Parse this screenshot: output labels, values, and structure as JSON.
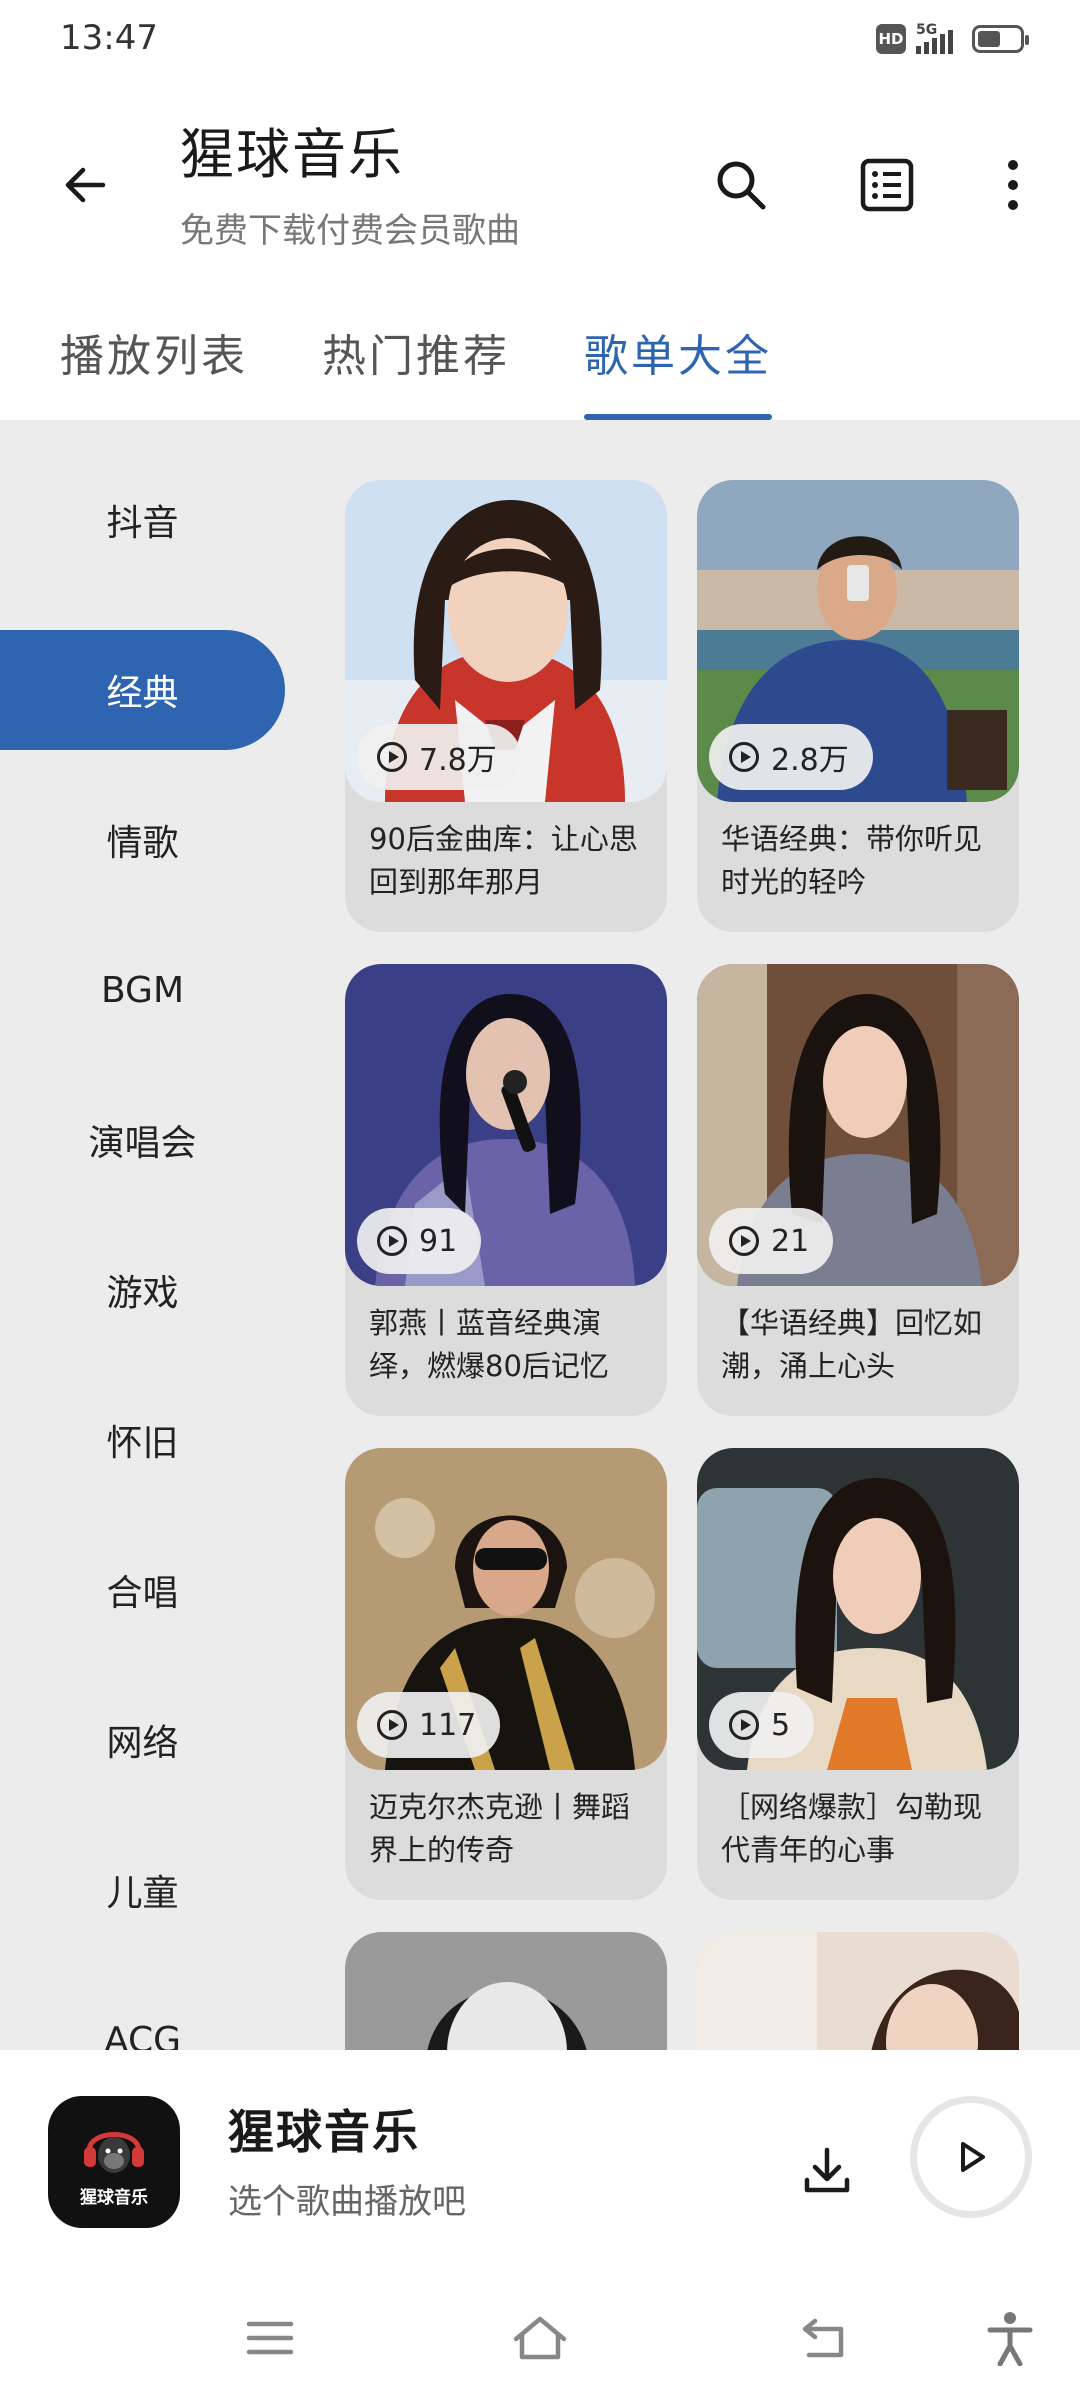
{
  "status_bar": {
    "time": "13:47",
    "hd": "HD",
    "network": "5G",
    "battery_percent": 55
  },
  "app_bar": {
    "title": "猩球音乐",
    "subtitle": "免费下载付费会员歌曲",
    "icons": [
      "back-arrow-icon",
      "search-icon",
      "list-icon",
      "more-vertical-icon"
    ]
  },
  "tabs": [
    {
      "label": "播放列表",
      "active": false
    },
    {
      "label": "热门推荐",
      "active": false
    },
    {
      "label": "歌单大全",
      "active": true
    }
  ],
  "categories": [
    {
      "label": "抖音",
      "active": false
    },
    {
      "label": "经典",
      "active": true
    },
    {
      "label": "情歌",
      "active": false
    },
    {
      "label": "BGM",
      "active": false
    },
    {
      "label": "演唱会",
      "active": false
    },
    {
      "label": "游戏",
      "active": false
    },
    {
      "label": "怀旧",
      "active": false
    },
    {
      "label": "合唱",
      "active": false
    },
    {
      "label": "网络",
      "active": false
    },
    {
      "label": "儿童",
      "active": false
    },
    {
      "label": "ACG",
      "active": false
    }
  ],
  "playlists": [
    {
      "plays": "7.8万",
      "title": "90后金曲库：让心思回到那年那月"
    },
    {
      "plays": "2.8万",
      "title": "华语经典：带你听见时光的轻吟"
    },
    {
      "plays": "91",
      "title": "郭燕丨蓝音经典演绎，燃爆80后记忆"
    },
    {
      "plays": "21",
      "title": "【华语经典】回忆如潮，涌上心头"
    },
    {
      "plays": "117",
      "title": "迈克尔杰克逊丨舞蹈界上的传奇"
    },
    {
      "plays": "5",
      "title": "［网络爆款］勾勒现代青年的心事"
    },
    {
      "plays": "",
      "title": ""
    },
    {
      "plays": "",
      "title": ""
    }
  ],
  "player": {
    "logo_text": "猩球音乐",
    "title": "猩球音乐",
    "subtitle": "选个歌曲播放吧",
    "icons": [
      "download-icon",
      "play-icon"
    ]
  },
  "nav_bar": {
    "icons": [
      "menu-icon",
      "home-icon",
      "back-icon",
      "accessibility-icon"
    ]
  },
  "colors": {
    "accent": "#2f64b0",
    "content_bg": "#ececec",
    "card_bg": "#dcdcdc"
  }
}
